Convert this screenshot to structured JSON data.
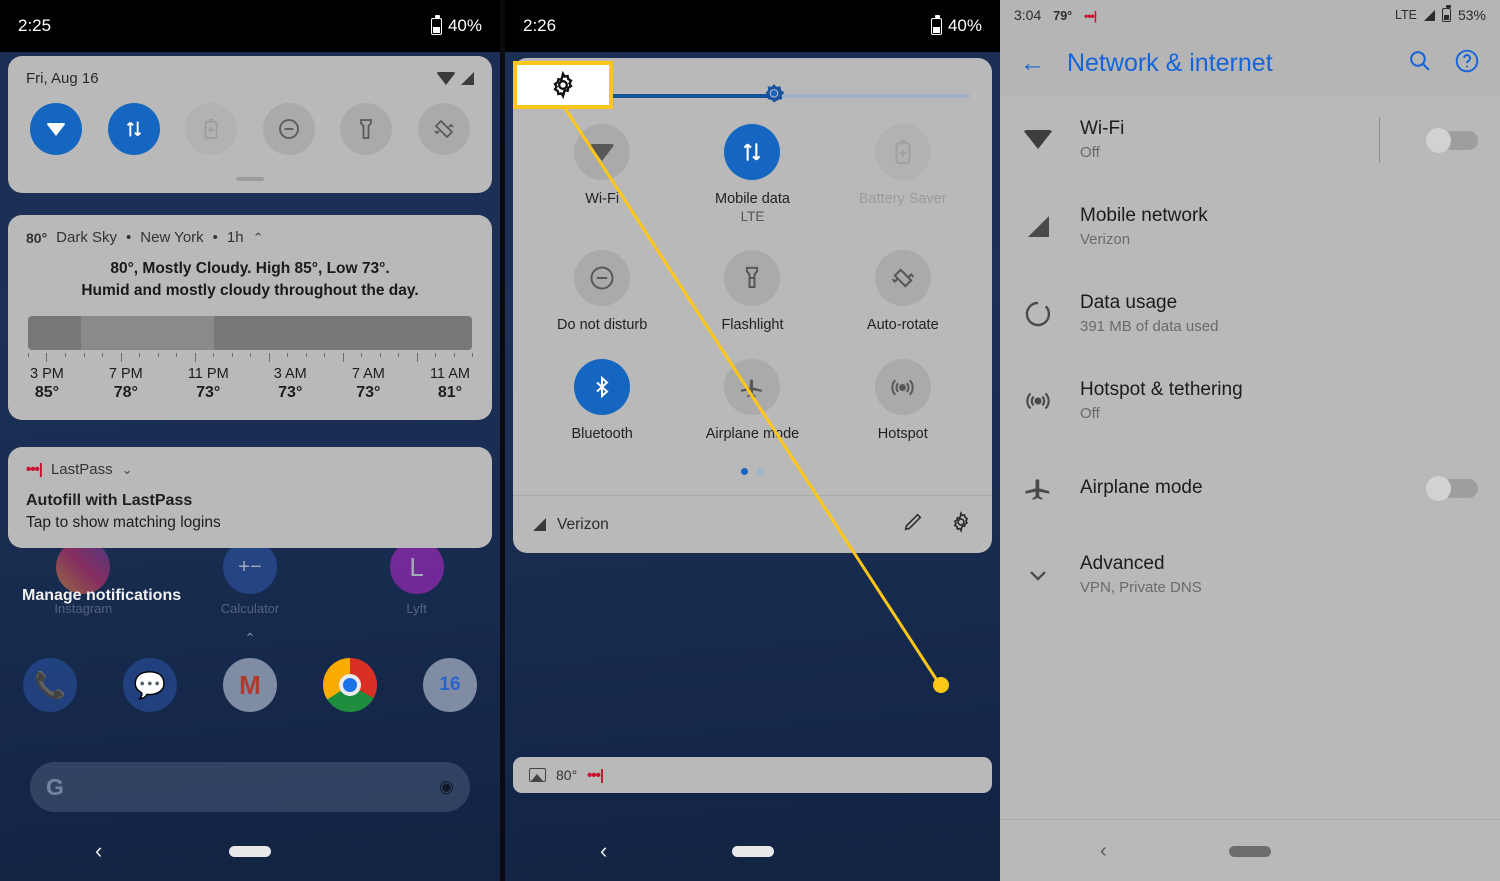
{
  "panel1": {
    "status": {
      "time": "2:25",
      "battery": "40%",
      "battery_icon": "battery-icon"
    },
    "shade": {
      "date": "Fri, Aug 16",
      "wifi_icon": "wifi-icon",
      "signal_icon": "signal-icon",
      "tiles": [
        {
          "name": "wifi",
          "state": "on",
          "glyph": "wifi"
        },
        {
          "name": "mobile-data",
          "state": "on",
          "glyph": "updown"
        },
        {
          "name": "battery-saver",
          "state": "dim",
          "glyph": "battery-plus"
        },
        {
          "name": "do-not-disturb",
          "state": "off",
          "glyph": "minus-circle"
        },
        {
          "name": "flashlight",
          "state": "off",
          "glyph": "flashlight"
        },
        {
          "name": "auto-rotate",
          "state": "off",
          "glyph": "rotate"
        }
      ]
    },
    "weather": {
      "temp": "80°",
      "source": "Dark Sky",
      "location": "New York",
      "interval": "1h",
      "collapse_icon": "chevron-up-icon",
      "headline": "80°, Mostly Cloudy. High 85°, Low 73°.",
      "detail": "Humid and mostly cloudy throughout the day.",
      "hours": [
        "3 PM",
        "7 PM",
        "11 PM",
        "3 AM",
        "7 AM",
        "11 AM"
      ],
      "temps": [
        "85°",
        "78°",
        "73°",
        "73°",
        "73°",
        "81°"
      ]
    },
    "lastpass": {
      "app": "LastPass",
      "dots": "•••|",
      "expand_icon": "chevron-down-icon",
      "title": "Autofill with LastPass",
      "subtitle": "Tap to show matching logins"
    },
    "manage_notifications": "Manage notifications",
    "home_apps_top": [
      {
        "label": "Instagram",
        "name": "instagram"
      },
      {
        "label": "Calculator",
        "name": "calculator"
      },
      {
        "label": "Lyft",
        "name": "lyft"
      }
    ],
    "dock_apps": [
      {
        "label": "Phone",
        "name": "phone"
      },
      {
        "label": "Messages",
        "name": "messages"
      },
      {
        "label": "Gmail",
        "name": "gmail"
      },
      {
        "label": "Chrome",
        "name": "chrome"
      },
      {
        "label": "Calendar",
        "name": "calendar",
        "day": "16"
      }
    ],
    "search": {
      "logo": "google-logo",
      "assistant": "assistant-icon"
    },
    "nav": {
      "back": "back-icon",
      "home": "home-pill"
    }
  },
  "panel2": {
    "status": {
      "time": "2:26",
      "battery": "40%"
    },
    "callout": {
      "icon": "gear-icon",
      "accent": "#ffc61a"
    },
    "brightness": {
      "percent": 55,
      "knob_icon": "brightness-icon"
    },
    "tiles": [
      {
        "label": "Wi-Fi",
        "sub": "",
        "state": "off",
        "glyph": "wifi",
        "name": "wifi"
      },
      {
        "label": "Mobile data",
        "sub": "LTE",
        "state": "on",
        "glyph": "updown",
        "name": "mobile-data"
      },
      {
        "label": "Battery Saver",
        "sub": "",
        "state": "dim",
        "glyph": "battery-plus",
        "name": "battery-saver"
      },
      {
        "label": "Do not disturb",
        "sub": "",
        "state": "off",
        "glyph": "minus-circle",
        "name": "do-not-disturb"
      },
      {
        "label": "Flashlight",
        "sub": "",
        "state": "off",
        "glyph": "flashlight",
        "name": "flashlight"
      },
      {
        "label": "Auto-rotate",
        "sub": "",
        "state": "off",
        "glyph": "rotate",
        "name": "auto-rotate"
      },
      {
        "label": "Bluetooth",
        "sub": "",
        "state": "on",
        "glyph": "bluetooth",
        "name": "bluetooth"
      },
      {
        "label": "Airplane mode",
        "sub": "",
        "state": "off",
        "glyph": "airplane",
        "name": "airplane-mode"
      },
      {
        "label": "Hotspot",
        "sub": "",
        "state": "off",
        "glyph": "hotspot",
        "name": "hotspot"
      }
    ],
    "pager": {
      "pages": 2,
      "active": 0
    },
    "footer": {
      "carrier": "Verizon",
      "carrier_icon": "signal-icon",
      "edit_icon": "pencil-icon",
      "settings_icon": "gear-icon"
    },
    "mini_notification": {
      "icon": "image-icon",
      "temp": "80°",
      "dots": "•••|"
    },
    "nav": {
      "back": "back-icon",
      "home": "home-pill"
    }
  },
  "panel3": {
    "status": {
      "time": "3:04",
      "temp": "79°",
      "dots": "•••|",
      "network": "LTE",
      "battery": "53%"
    },
    "appbar": {
      "back_icon": "back-arrow-icon",
      "title": "Network & internet",
      "search_icon": "search-icon",
      "help_icon": "help-icon"
    },
    "rows": [
      {
        "name": "wifi",
        "icon": "wifi-icon",
        "title": "Wi-Fi",
        "sub": "Off",
        "toggle": "off",
        "divider": true
      },
      {
        "name": "mobile-network",
        "icon": "signal-icon",
        "title": "Mobile network",
        "sub": "Verizon",
        "toggle": null,
        "divider": false
      },
      {
        "name": "data-usage",
        "icon": "data-usage-icon",
        "title": "Data usage",
        "sub": "391 MB of data used",
        "toggle": null,
        "divider": false
      },
      {
        "name": "hotspot-tethering",
        "icon": "hotspot-icon",
        "title": "Hotspot & tethering",
        "sub": "Off",
        "toggle": null,
        "divider": false
      },
      {
        "name": "airplane-mode",
        "icon": "airplane-icon",
        "title": "Airplane mode",
        "sub": "",
        "toggle": "off",
        "divider": false
      },
      {
        "name": "advanced",
        "icon": "chevron-down-icon",
        "title": "Advanced",
        "sub": "VPN, Private DNS",
        "toggle": null,
        "divider": false
      }
    ],
    "nav": {
      "back": "back-icon",
      "home": "home-pill"
    }
  }
}
